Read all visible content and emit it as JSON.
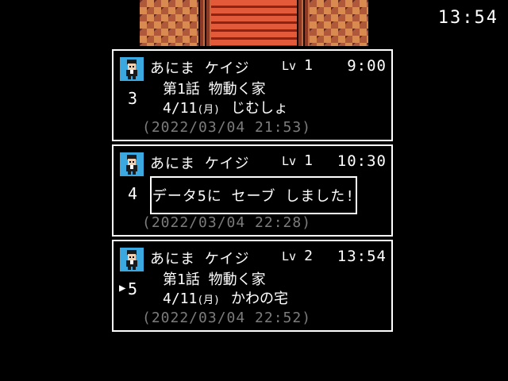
{
  "clock": "13:54",
  "lv_label": "Lv",
  "slots": [
    {
      "slot_number": "3",
      "name": "あにま ケイジ",
      "level": "1",
      "play_time": "9:00",
      "chapter": "第1話 物動く家",
      "date": "4/11",
      "weekday": "(月)",
      "location": "じむしょ",
      "saved_at": "(2022/03/04 21:53)",
      "selected": false
    },
    {
      "slot_number": "4",
      "name": "あにま ケイジ",
      "level": "1",
      "play_time": "10:30",
      "saved_at": "(2022/03/04 22:28)",
      "selected": false
    },
    {
      "slot_number": "5",
      "name": "あにま ケイジ",
      "level": "2",
      "play_time": "13:54",
      "chapter": "第1話 物動く家",
      "date": "4/11",
      "weekday": "(月)",
      "location": "かわの宅",
      "saved_at": "(2022/03/04 22:52)",
      "selected": true
    }
  ],
  "cursor": "▶",
  "dialog": {
    "message": "データ5に セーブ しました!"
  },
  "icons": {
    "avatar": "character-portrait-icon",
    "cursor": "selection-cursor-icon"
  },
  "colors": {
    "background": "#000000",
    "text": "#ffffff",
    "timestamp": "#7c7c7c",
    "avatar_bg": "#3ca8e0",
    "border": "#ffffff"
  }
}
